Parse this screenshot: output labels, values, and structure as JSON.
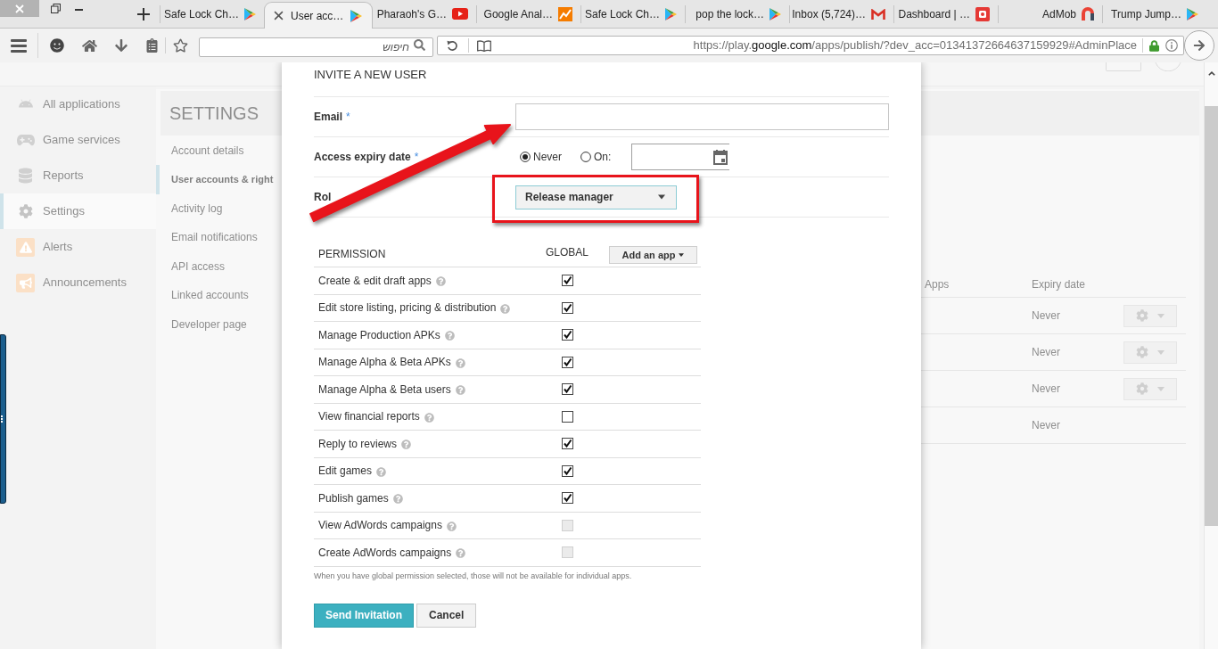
{
  "tabs": [
    {
      "title": "Safe Lock Ch…",
      "kind": "play",
      "selected": false
    },
    {
      "title": "User acc…",
      "kind": "play",
      "selected": true
    },
    {
      "title": "Pharaoh's G…",
      "kind": "video",
      "selected": false
    },
    {
      "title": "Google Anal…",
      "kind": "chart",
      "selected": false
    },
    {
      "title": "Safe Lock Ch…",
      "kind": "play",
      "selected": false
    },
    {
      "title": "pop the lock…",
      "kind": "play",
      "selected": false
    },
    {
      "title": "Inbox (5,724)…",
      "kind": "mail",
      "selected": false
    },
    {
      "title": "Dashboard | …",
      "kind": "badge",
      "selected": false
    },
    {
      "title": "AdMob",
      "kind": "arch",
      "selected": false
    },
    {
      "title": "Trump Jump…",
      "kind": "play",
      "selected": false
    }
  ],
  "toolbar": {
    "search": {
      "placeholder": "חיפוש"
    },
    "url": {
      "prefix": "https://play.",
      "domain": "google.com",
      "path": "/apps/publish/?dev_acc=01341372664637159929#AdminPlace"
    }
  },
  "page": {
    "nav": [
      {
        "label": "All applications",
        "kind": "robot",
        "selected": false
      },
      {
        "label": "Game services",
        "kind": "gamepad",
        "selected": false
      },
      {
        "label": "Reports",
        "kind": "database",
        "selected": false
      },
      {
        "label": "Settings",
        "kind": "gear",
        "selected": true
      },
      {
        "label": "Alerts",
        "kind": "warning",
        "selected": false
      },
      {
        "label": "Announcements",
        "kind": "megaphone",
        "selected": false
      }
    ],
    "settings": {
      "title": "SETTINGS",
      "items": [
        {
          "label": "Account details",
          "selected": false
        },
        {
          "label": "User accounts & right",
          "selected": true
        },
        {
          "label": "Activity log",
          "selected": false
        },
        {
          "label": "Email notifications",
          "selected": false
        },
        {
          "label": "API access",
          "selected": false
        },
        {
          "label": "Linked accounts",
          "selected": false
        },
        {
          "label": "Developer page",
          "selected": false
        }
      ]
    },
    "users_table": {
      "columns": [
        "Apps",
        "Expiry date"
      ],
      "rows": [
        {
          "expiry": "Never",
          "menu": true
        },
        {
          "expiry": "Never",
          "menu": true
        },
        {
          "expiry": "Never",
          "menu": true
        },
        {
          "expiry": "Never",
          "menu": false
        }
      ]
    }
  },
  "dialog": {
    "title": "INVITE A NEW USER",
    "email": {
      "label": "Email",
      "mark": "*"
    },
    "expiry": {
      "label": "Access expiry date",
      "mark": "*",
      "options": [
        {
          "label": "Never",
          "selected": true
        },
        {
          "label": "On:",
          "selected": false
        }
      ]
    },
    "role": {
      "label": "Rol",
      "value": "Release manager"
    },
    "permissions": {
      "columns": [
        "PERMISSION",
        "GLOBAL"
      ],
      "add_button": "Add an app",
      "rows": [
        {
          "label": "Create & edit draft apps",
          "checked": true,
          "disabled": false
        },
        {
          "label": "Edit store listing, pricing & distribution",
          "checked": true,
          "disabled": false
        },
        {
          "label": "Manage Production APKs",
          "checked": true,
          "disabled": false
        },
        {
          "label": "Manage Alpha & Beta APKs",
          "checked": true,
          "disabled": false
        },
        {
          "label": "Manage Alpha & Beta users",
          "checked": true,
          "disabled": false
        },
        {
          "label": "View financial reports",
          "checked": false,
          "disabled": false
        },
        {
          "label": "Reply to reviews",
          "checked": true,
          "disabled": false
        },
        {
          "label": "Edit games",
          "checked": true,
          "disabled": false
        },
        {
          "label": "Publish games",
          "checked": true,
          "disabled": false
        },
        {
          "label": "View AdWords campaigns",
          "checked": false,
          "disabled": true
        },
        {
          "label": "Create AdWords campaigns",
          "checked": false,
          "disabled": true
        }
      ],
      "note": "When you have global permission selected, those will not be available for individual apps."
    },
    "buttons": [
      {
        "label": "Send Invitation",
        "kind": "primary"
      },
      {
        "label": "Cancel",
        "kind": "secondary"
      }
    ]
  }
}
